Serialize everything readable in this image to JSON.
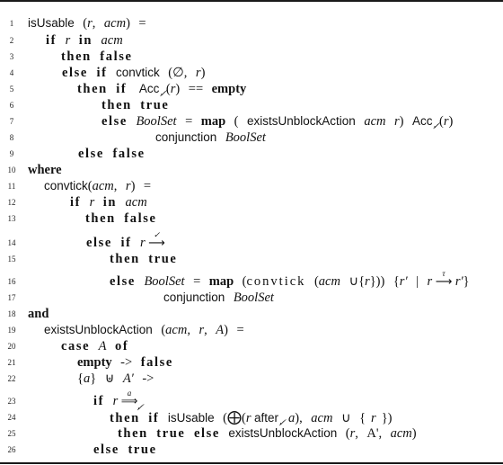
{
  "figure": {
    "kind": "algorithm-listing",
    "lines": [
      {
        "n": "1"
      },
      {
        "n": "2"
      },
      {
        "n": "3"
      },
      {
        "n": "4"
      },
      {
        "n": "5"
      },
      {
        "n": "6"
      },
      {
        "n": "7"
      },
      {
        "n": "8"
      },
      {
        "n": "9"
      },
      {
        "n": "10"
      },
      {
        "n": "11"
      },
      {
        "n": "12"
      },
      {
        "n": "13"
      },
      {
        "n": "14"
      },
      {
        "n": "15"
      },
      {
        "n": "16"
      },
      {
        "n": "17"
      },
      {
        "n": "18"
      },
      {
        "n": "19"
      },
      {
        "n": "20"
      },
      {
        "n": "21"
      },
      {
        "n": "22"
      },
      {
        "n": "23"
      },
      {
        "n": "24"
      },
      {
        "n": "25"
      },
      {
        "n": "26"
      }
    ]
  },
  "tokens": {
    "isUsable": "isUsable",
    "convtick_fn": "convtick",
    "convtick_mono": "convtick",
    "existsUnblockAction": "existsUnblockAction",
    "conjunction": "conjunction",
    "Acc": "Acc",
    "not_tick_sub": "✓̸",
    "tick": "✓",
    "tau": "τ",
    "a": "a",
    "after": "after",
    "kw_if": "if",
    "kw_in": "in",
    "kw_then": "then",
    "kw_else": "else",
    "kw_false": "false",
    "kw_true": "true",
    "kw_where": "where",
    "kw_and": "and",
    "kw_case": "case",
    "kw_of": "of",
    "kw_empty": "empty",
    "kw_map": "map",
    "var_r": "r",
    "var_acm": "acm",
    "var_A": "A",
    "var_Aprime": "A′",
    "var_Aquote": "A'",
    "var_rprime": "r′",
    "BoolSet": "BoolSet",
    "emptyset": "∅",
    "eq": "=",
    "eqeq": "==",
    "arrow_kw": "->",
    "union": "∪",
    "multiset_union": "⊎",
    "oplus": "⨁",
    "right_arrow": "⟶",
    "double_arrow": "⟹",
    "bar": "|"
  }
}
